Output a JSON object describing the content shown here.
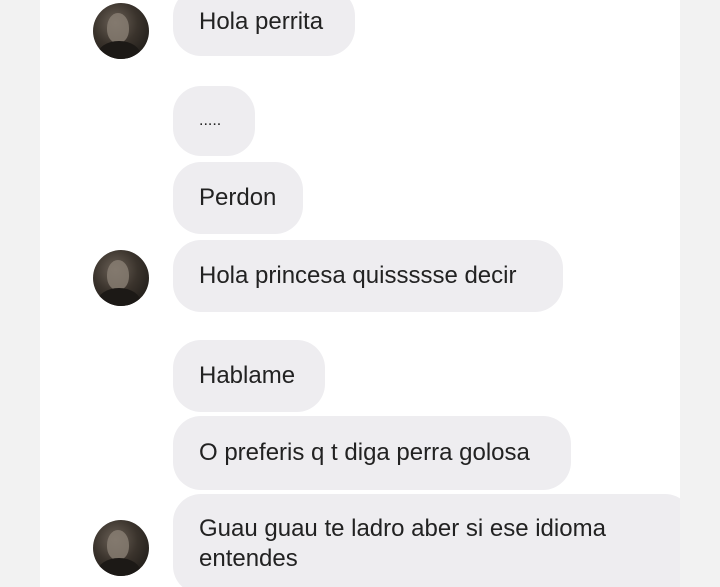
{
  "chat": {
    "messages": [
      {
        "text": "Hola perrita"
      },
      {
        "text": "....."
      },
      {
        "text": "Perdon"
      },
      {
        "text": "Hola princesa quissssse decir"
      },
      {
        "text": "Hablame"
      },
      {
        "text": "O preferis q t diga perra golosa"
      },
      {
        "line1": "Guau guau te ladro aber si ese idioma",
        "line2": "entendes"
      }
    ]
  },
  "colors": {
    "bubble": "#eeedf0",
    "text": "#222222",
    "background": "#ffffff",
    "outer": "#f2f2f2"
  },
  "icons": {
    "avatar": "sender-avatar-photo"
  }
}
